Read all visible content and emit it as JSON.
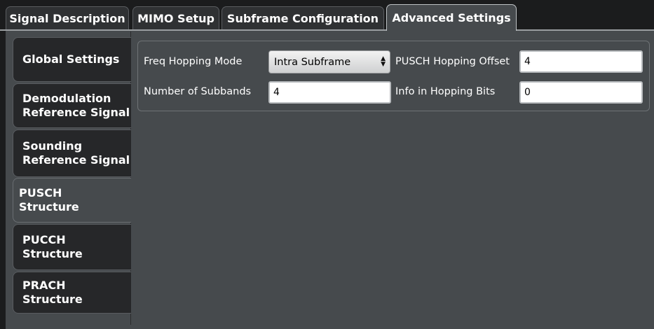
{
  "top_tabs": [
    {
      "label": "Signal Description"
    },
    {
      "label": "MIMO Setup"
    },
    {
      "label": "Subframe Configuration"
    },
    {
      "label": "Advanced Settings",
      "active": true
    }
  ],
  "side_tabs": [
    {
      "label": "Global Settings"
    },
    {
      "label": "Demodulation\nReference Signal"
    },
    {
      "label": "Sounding\nReference Signal"
    },
    {
      "label": "PUSCH\nStructure",
      "active": true
    },
    {
      "label": "PUCCH\nStructure"
    },
    {
      "label": "PRACH\nStructure"
    }
  ],
  "pusch": {
    "freq_hopping_mode": {
      "label": "Freq Hopping Mode",
      "value": "Intra Subframe"
    },
    "pusch_hopping_offset": {
      "label": "PUSCH Hopping Offset",
      "value": "4"
    },
    "number_of_subbands": {
      "label": "Number of Subbands",
      "value": "4"
    },
    "info_in_hopping_bits": {
      "label": "Info in Hopping Bits",
      "value": "0"
    }
  },
  "colors": {
    "panel": "#464a4d",
    "tab_inactive": "#262729",
    "background": "#1b1c1d"
  }
}
